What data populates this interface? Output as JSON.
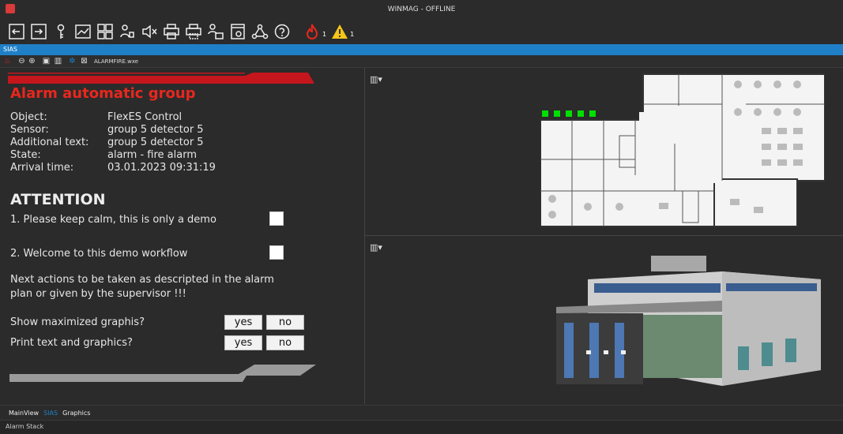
{
  "window": {
    "title": "WINMAG - OFFLINE"
  },
  "toolbar": {
    "icons": [
      "exit-icon",
      "login-icon",
      "key-icon",
      "chart-icon",
      "grid-icon",
      "user-switch-icon",
      "mute-icon",
      "print-icon",
      "print-preview-icon",
      "users-icon",
      "window-icon",
      "network-icon",
      "help-icon",
      "fire-icon",
      "warning-icon"
    ],
    "fire_count": "1",
    "warning_count": "1"
  },
  "sias_bar": {
    "label": "SIAS"
  },
  "subtoolbar": {
    "filename": "ALARMFIRE.wxe"
  },
  "alarm": {
    "heading": "Alarm automatic group",
    "fields": [
      {
        "k": "Object:",
        "v": "FlexES Control"
      },
      {
        "k": "Sensor:",
        "v": "group 5 detector 5"
      },
      {
        "k": "Additional text:",
        "v": "group 5 detector 5"
      },
      {
        "k": "State:",
        "v": "alarm - fire alarm"
      },
      {
        "k": "Arrival time:",
        "v": "03.01.2023 09:31:19"
      }
    ],
    "attention": "ATTENTION",
    "task1": "1. Please keep calm, this is only a demo",
    "task2": "2. Welcome to this demo workflow",
    "note": "Next actions to be taken as descripted in the alarm plan or given by the supervisor !!!",
    "q1": "Show maximized graphis?",
    "q2": "Print text and graphics?",
    "yes": "yes",
    "no": "no"
  },
  "tabs": [
    "MainView",
    "SIAS",
    "Graphics"
  ],
  "alarm_stack": {
    "label": "Alarm Stack"
  },
  "colors": {
    "accent": "#1f80c8",
    "alarm_red": "#e8271e"
  }
}
